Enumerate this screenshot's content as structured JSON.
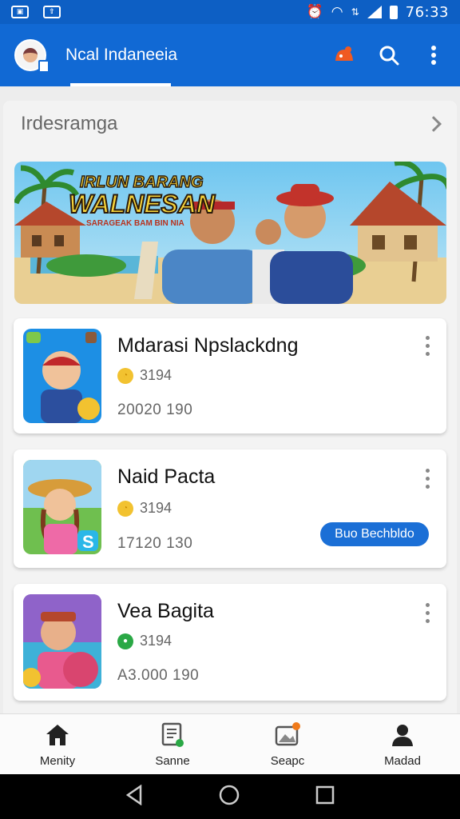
{
  "status_bar": {
    "time": "76:33",
    "left_icons": [
      "image-icon",
      "upload-icon"
    ],
    "right_icons": [
      "alarm-icon",
      "wifi-icon",
      "data-icon",
      "signal-icon",
      "battery-icon"
    ]
  },
  "app_bar": {
    "title": "Ncal Indaneeia",
    "actions": [
      "notification-icon",
      "search-icon",
      "more-vertical-icon"
    ]
  },
  "section": {
    "title": "Irdesramga"
  },
  "banner": {
    "headline_line1": "IRLUN BARANG",
    "headline_line2": "WALNESAN",
    "tagline": "SARAGEAK BAM BIN NIA"
  },
  "cards": [
    {
      "title": "Mdarasi Npslackdng",
      "meta": "3194",
      "sub": "20020 190",
      "button": "",
      "thumb_bg": "#1d8fe4",
      "coin_color": "#f2c230"
    },
    {
      "title": "Naid Pacta",
      "meta": "3194",
      "sub": "17120 130",
      "button": "Buo Bechbldo",
      "thumb_bg": "#6fbf4f",
      "coin_color": "#f2c230"
    },
    {
      "title": "Vea Bagita",
      "meta": "3194",
      "sub": "A3.000 190",
      "button": "",
      "thumb_bg": "#7b5bc2",
      "coin_color": "#2aa845"
    }
  ],
  "bottom_nav": [
    {
      "label": "Menity",
      "icon": "home-icon"
    },
    {
      "label": "Sanne",
      "icon": "document-icon"
    },
    {
      "label": "Seapc",
      "icon": "gallery-icon"
    },
    {
      "label": "Madad",
      "icon": "person-icon"
    }
  ],
  "colors": {
    "primary": "#1169d4",
    "status_bar": "#0d5fc4",
    "accent_orange": "#f05a22",
    "pill": "#1b6fd6"
  }
}
